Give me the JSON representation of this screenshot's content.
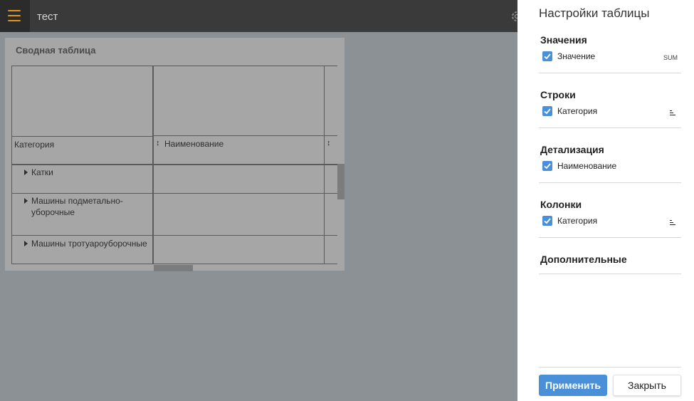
{
  "app": {
    "title": "тест"
  },
  "pivot": {
    "title": "Сводная таблица",
    "row_header": "Категория",
    "col_header": "Наименование",
    "rows": [
      "Катки",
      "Машины подметально-\nуборочные",
      "Машины тротуароуборочные"
    ]
  },
  "panel": {
    "title": "Настройки таблицы",
    "sections": {
      "values": {
        "title": "Значения",
        "item": "Значение",
        "agg": "SUM"
      },
      "rows": {
        "title": "Строки",
        "item": "Категория"
      },
      "detail": {
        "title": "Детализация",
        "item": "Наименование"
      },
      "columns": {
        "title": "Колонки",
        "item": "Категория"
      },
      "extra": {
        "title": "Дополнительные"
      }
    },
    "apply_label": "Применить",
    "close_label": "Закрыть"
  },
  "colors": {
    "accent": "#4a90d9",
    "menu": "#e0951f"
  }
}
